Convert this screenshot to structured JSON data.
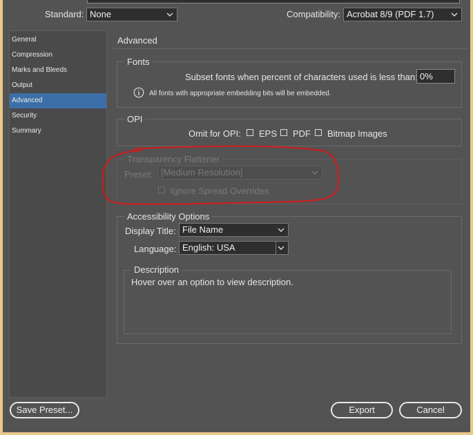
{
  "header": {
    "standard_label": "Standard:",
    "standard_value": "None",
    "compatibility_label": "Compatibility:",
    "compatibility_value": "Acrobat 8/9 (PDF 1.7)"
  },
  "sidebar": {
    "items": [
      {
        "label": "General"
      },
      {
        "label": "Compression"
      },
      {
        "label": "Marks and Bleeds"
      },
      {
        "label": "Output"
      },
      {
        "label": "Advanced"
      },
      {
        "label": "Security"
      },
      {
        "label": "Summary"
      }
    ],
    "selected": "Advanced"
  },
  "panel": {
    "title": "Advanced",
    "fonts": {
      "title": "Fonts",
      "subset_label": "Subset fonts when percent of characters used is less than:",
      "subset_value": "0%",
      "info_text": "All fonts with appropriate embedding bits will be embedded."
    },
    "opi": {
      "title": "OPI",
      "omit_label": "Omit for OPI:",
      "eps_label": "EPS",
      "pdf_label": "PDF",
      "bitmap_label": "Bitmap Images"
    },
    "transparency": {
      "title": "Transparency Flattener",
      "preset_label": "Preset:",
      "preset_value": "[Medium Resolution]",
      "ignore_label": "Ignore Spread Overrides"
    },
    "accessibility": {
      "title": "Accessibility Options",
      "display_title_label": "Display Title:",
      "display_title_value": "File Name",
      "language_label": "Language:",
      "language_value": "English: USA"
    },
    "description": {
      "title": "Description",
      "text": "Hover over an option to view description."
    }
  },
  "footer": {
    "save_preset_label": "Save Preset...",
    "export_label": "Export",
    "cancel_label": "Cancel"
  },
  "colors": {
    "dialog_bg": "#535353",
    "selection": "#3c6fa8",
    "annotation": "#c81e1e",
    "frame": "#e9c98a"
  }
}
